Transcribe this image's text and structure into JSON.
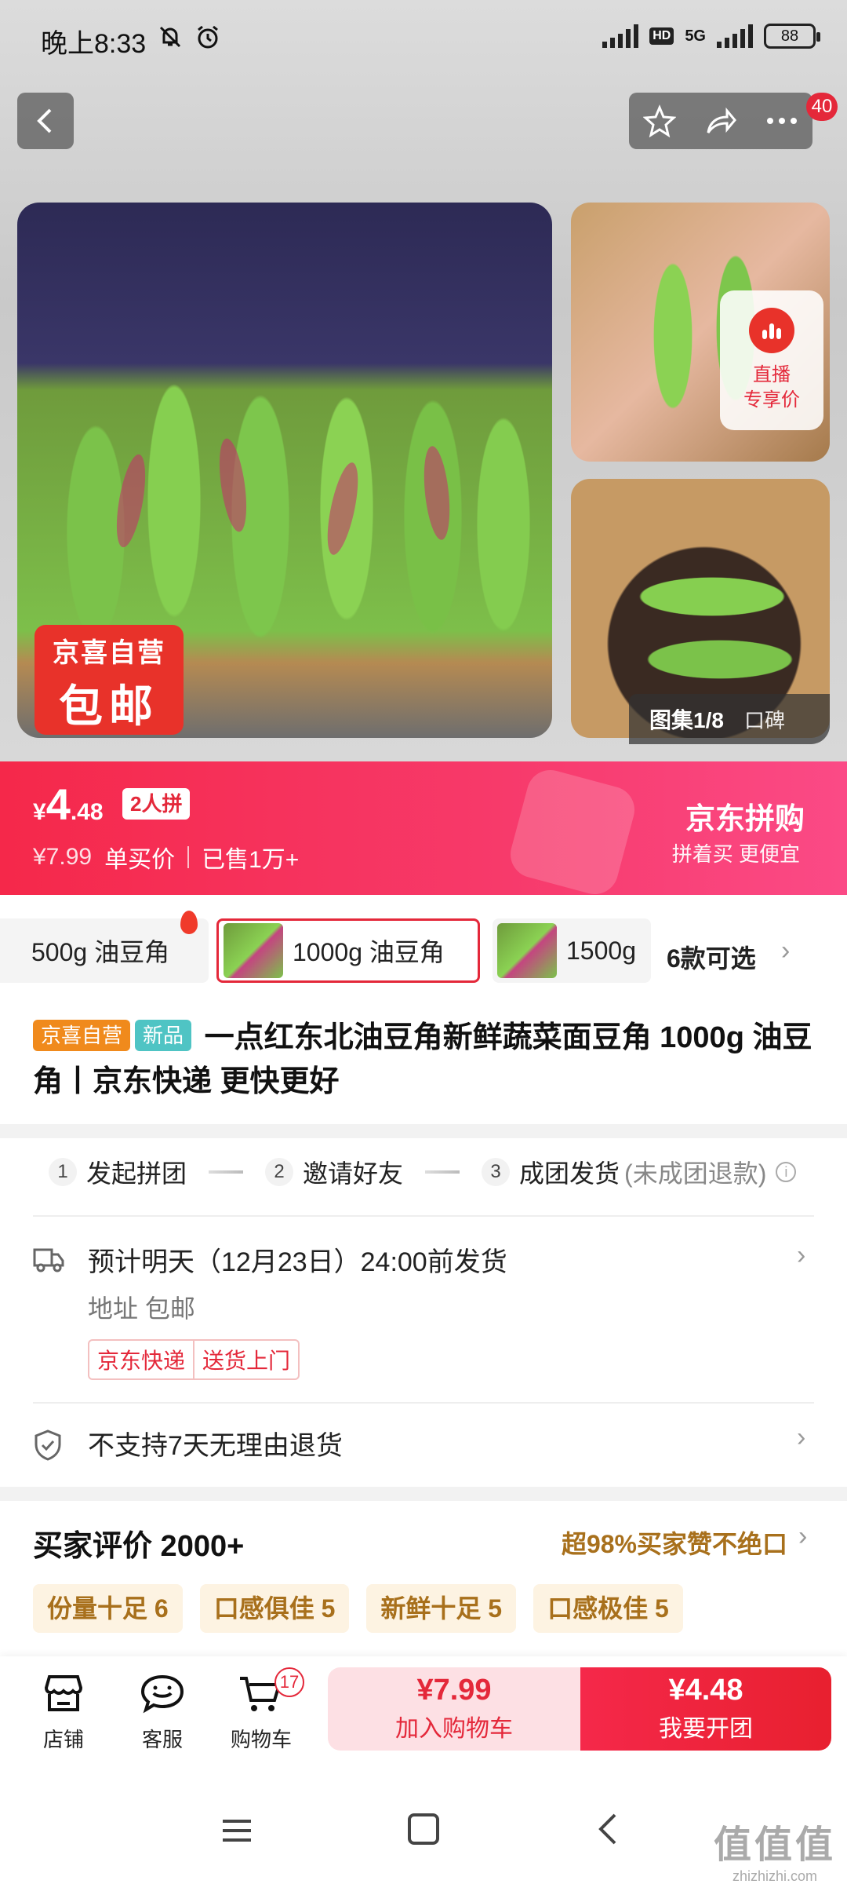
{
  "status_bar": {
    "time": "晚上8:33",
    "network": "5G",
    "hd": "HD",
    "battery": "88"
  },
  "top_nav": {
    "cart_count": "40"
  },
  "gallery": {
    "main_tag_line1": "京喜自营",
    "main_tag_line2": "包邮",
    "live_line1": "直播",
    "live_line2": "专享价",
    "counter": "图集1/8",
    "koubei": "口碑"
  },
  "price": {
    "currency": "¥",
    "int": "4",
    "dec": ".48",
    "group_tag": "2人拼",
    "single_price": "¥7.99",
    "single_label": "单买价",
    "sold": "已售1万+",
    "promo_title": "京东拼购",
    "promo_sub": "拼着买 更便宜"
  },
  "variants": {
    "items": [
      {
        "label": "500g 油豆角",
        "selected": false
      },
      {
        "label": "1000g 油豆角",
        "selected": true
      },
      {
        "label": "1500g",
        "selected": false
      }
    ],
    "more": "6款可选"
  },
  "product": {
    "tag1": "京喜自营",
    "tag2": "新品",
    "title": "一点红东北油豆角新鲜蔬菜面豆角 1000g 油豆角丨京东快递 更快更好"
  },
  "steps": {
    "s1_num": "1",
    "s1": "发起拼团",
    "s2_num": "2",
    "s2": "邀请好友",
    "s3_num": "3",
    "s3": "成团发货",
    "note": "(未成团退款)"
  },
  "delivery": {
    "eta": "预计明天（12月23日）24:00前发货",
    "address_line": "地址  包邮",
    "tag1": "京东快递",
    "tag2": "送货上门",
    "no_return": "不支持7天无理由退货"
  },
  "reviews": {
    "title": "买家评价 2000+",
    "good_rate": "超98%买家赞不绝口",
    "tags": [
      "份量十足 6",
      "口感俱佳 5",
      "新鲜十足 5",
      "口感极佳 5"
    ]
  },
  "bottom_bar": {
    "store": "店铺",
    "service": "客服",
    "cart": "购物车",
    "cart_badge": "17",
    "cart_price": "¥7.99",
    "cart_label": "加入购物车",
    "group_price": "¥4.48",
    "group_label": "我要开团"
  },
  "watermark": {
    "line1": "值值值",
    "line2": "zhizhizhi.com"
  },
  "colors": {
    "accent": "#e4283a",
    "banner_start": "#f5284a",
    "banner_end": "#fb4a86",
    "review_gold": "#a8701c"
  }
}
